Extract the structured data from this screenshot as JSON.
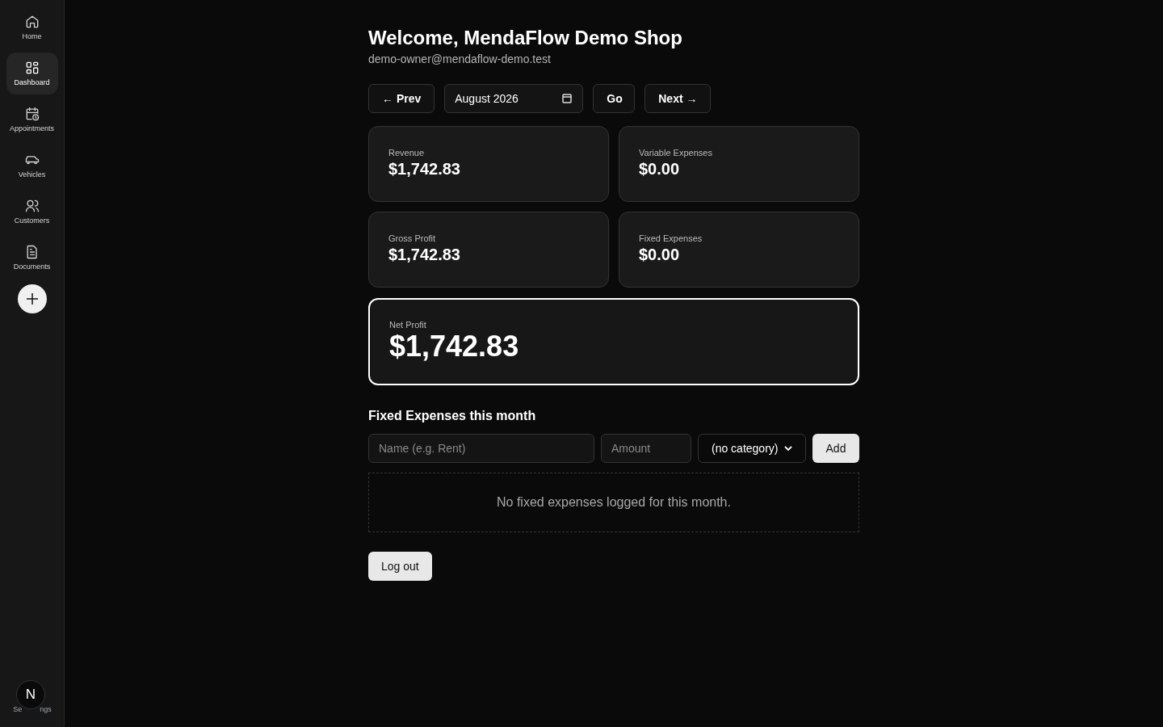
{
  "sidebar": {
    "items": [
      {
        "label": "Home",
        "selected": false
      },
      {
        "label": "Dashboard",
        "selected": true
      },
      {
        "label": "Appointments",
        "selected": false
      },
      {
        "label": "Vehicles",
        "selected": false
      },
      {
        "label": "Customers",
        "selected": false
      },
      {
        "label": "Documents",
        "selected": false
      }
    ],
    "settings": {
      "label_parts": [
        "Se",
        "ngs"
      ],
      "avatar": "N"
    }
  },
  "header": {
    "title": "Welcome, MendaFlow Demo Shop",
    "email": "demo-owner@mendaflow-demo.test"
  },
  "month_nav": {
    "prev": "← Prev",
    "month": "August 2026",
    "go": "Go",
    "next": "Next →"
  },
  "stats": [
    {
      "label": "Revenue",
      "value": "$1,742.83"
    },
    {
      "label": "Variable Expenses",
      "value": "$0.00"
    },
    {
      "label": "Gross Profit",
      "value": "$1,742.83"
    },
    {
      "label": "Fixed Expenses",
      "value": "$0.00"
    }
  ],
  "net_profit": {
    "label": "Net Profit",
    "value": "$1,742.83"
  },
  "fixed_expenses": {
    "title": "Fixed Expenses this month",
    "name_placeholder": "Name (e.g. Rent)",
    "amount_placeholder": "Amount",
    "category": "(no category)",
    "add": "Add",
    "empty": "No fixed expenses logged for this month."
  },
  "logout": "Log out"
}
